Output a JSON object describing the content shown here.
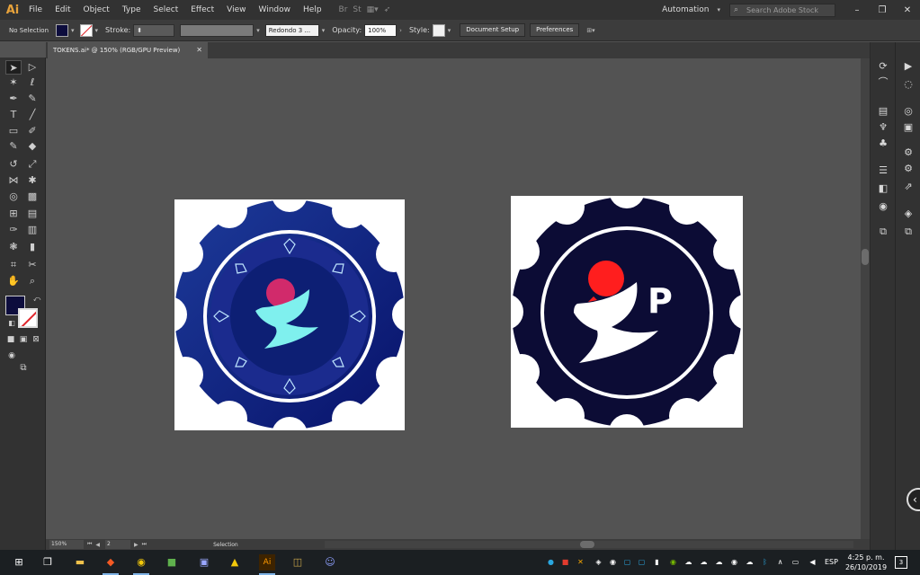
{
  "app": {
    "logo": "Ai",
    "menus": [
      "File",
      "Edit",
      "Object",
      "Type",
      "Select",
      "Effect",
      "View",
      "Window",
      "Help"
    ],
    "workspace": "Automation",
    "search_placeholder": "Search Adobe Stock",
    "bridge_label": "Br",
    "stock_label": "St"
  },
  "control_bar": {
    "selection_status": "No Selection",
    "stroke_label": "Stroke:",
    "brush_value": "Redondo 3 ...",
    "opacity_label": "Opacity:",
    "opacity_value": "100%",
    "style_label": "Style:",
    "document_setup": "Document Setup",
    "preferences": "Preferences",
    "fill_color": "#0d0d3d"
  },
  "document": {
    "tab_title": "TOKENS.ai* @ 150% (RGB/GPU Preview)",
    "close_glyph": "✕"
  },
  "status_bar": {
    "zoom": "150%",
    "page": "2",
    "tool": "Selection"
  },
  "taskbar": {
    "language": "ESP",
    "time": "4:25 p. m.",
    "date": "26/10/2019",
    "notifications": "3",
    "ai_label": "Ai"
  },
  "artwork": {
    "left_gear_colors": [
      "#1d2f86",
      "#0b1e6e"
    ],
    "left_ring_color": "#ffffff",
    "left_center_color": "#1b2b8e",
    "left_dot_color": "#d12a6b",
    "left_figure_color": "#7ff0ee",
    "left_diamond_color": "#bfe6ff",
    "right_gear_color": "#0c0c35",
    "right_dot_color": "#ff1e1e",
    "right_figure_color": "#ffffff",
    "right_letter": "P"
  }
}
